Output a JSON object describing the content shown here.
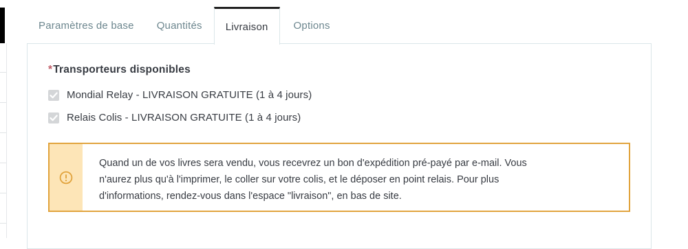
{
  "tabs": [
    {
      "label": "Paramètres de base",
      "active": false
    },
    {
      "label": "Quantités",
      "active": false
    },
    {
      "label": "Livraison",
      "active": true
    },
    {
      "label": "Options",
      "active": false
    }
  ],
  "section": {
    "required_marker": "*",
    "title": "Transporteurs disponibles"
  },
  "carriers": [
    {
      "label": "Mondial Relay - LIVRAISON GRATUITE (1 à 4 jours)",
      "checked": true
    },
    {
      "label": "Relais Colis - LIVRAISON GRATUITE (1 à 4 jours)",
      "checked": true
    }
  ],
  "alert": {
    "icon": "warning-circle-icon",
    "lines": [
      "Quand un de vos livres sera vendu, vous recevrez un bon d'expédition pré-payé par e-mail. Vous",
      "n'aurez plus qu'à l'imprimer, le coller sur votre colis, et le déposer en point relais. Pour plus",
      "d'informations, rendez-vous dans l'espace \"livraison\", en bas de site."
    ]
  },
  "colors": {
    "alert_border": "#e1a33c",
    "alert_icon_bg": "#fde5b7",
    "required": "#c05c67"
  }
}
